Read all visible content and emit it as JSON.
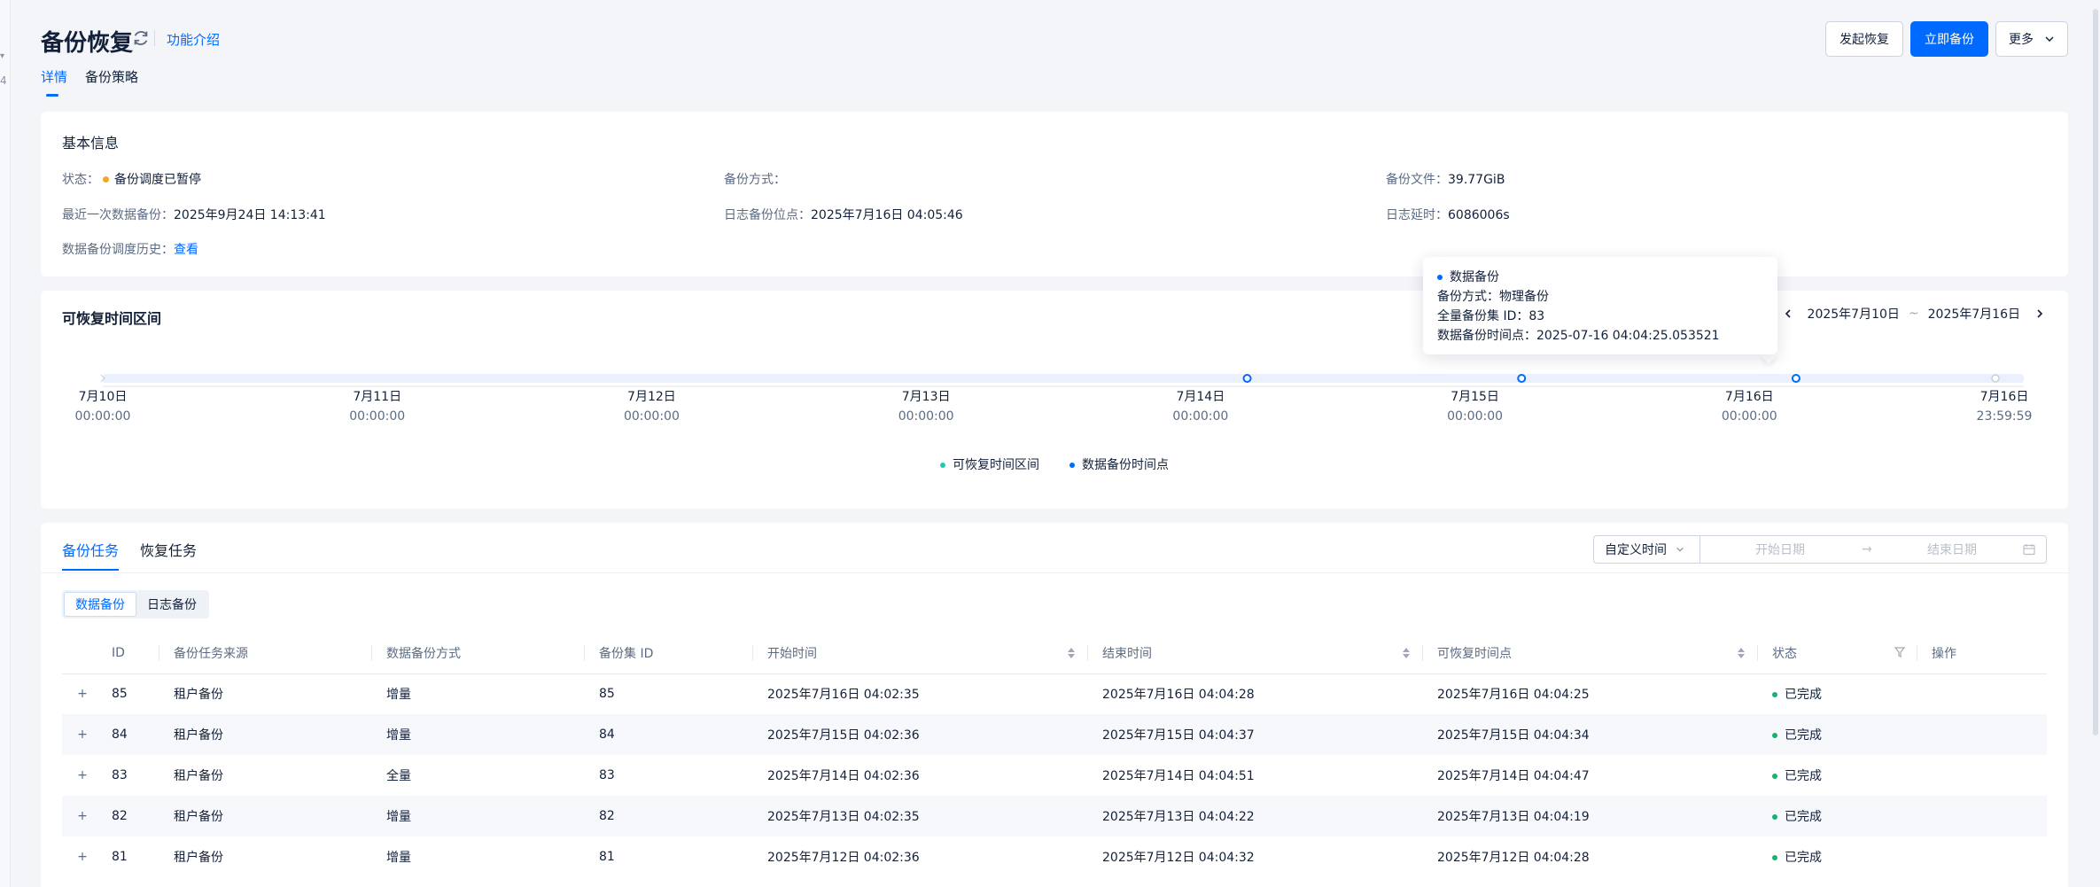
{
  "left_strip": {
    "glyph_top": "▾",
    "glyph_mid": "4"
  },
  "header": {
    "title": "备份恢复",
    "intro_link": "功能介绍",
    "buttons": {
      "restore": "发起恢复",
      "backup_now": "立即备份",
      "more": "更多"
    }
  },
  "page_tabs": [
    {
      "label": "详情"
    },
    {
      "label": "备份策略"
    }
  ],
  "basic_info": {
    "title": "基本信息",
    "status_label": "状态：",
    "status_value": "备份调度已暂停",
    "status_color": "#f5a623",
    "method_label": "备份方式：",
    "method_value": "",
    "file_label": "备份文件：",
    "file_value": "39.77GiB",
    "last_backup_label": "最近一次数据备份：",
    "last_backup_value": "2025年9月24日 14:13:41",
    "log_point_label": "日志备份位点：",
    "log_point_value": "2025年7月16日 04:05:46",
    "log_delay_label": "日志延时：",
    "log_delay_value": "6086006s",
    "history_label": "数据备份调度历史：",
    "history_link": "查看"
  },
  "range": {
    "title": "可恢复时间区间",
    "start_date": "2025年7月10日",
    "end_date": "2025年7月16日",
    "tilde": "~",
    "ticks": [
      {
        "date": "7月10日",
        "time": "00:00:00"
      },
      {
        "date": "7月11日",
        "time": "00:00:00"
      },
      {
        "date": "7月12日",
        "time": "00:00:00"
      },
      {
        "date": "7月13日",
        "time": "00:00:00"
      },
      {
        "date": "7月14日",
        "time": "00:00:00"
      },
      {
        "date": "7月15日",
        "time": "00:00:00"
      },
      {
        "date": "7月16日",
        "time": "00:00:00"
      },
      {
        "date": "7月16日",
        "time": "23:59:59"
      }
    ],
    "backup_point_days": [
      4.17,
      5.17,
      6.17
    ],
    "legend": [
      {
        "label": "可恢复时间区间",
        "color": "#20c9b1"
      },
      {
        "label": "数据备份时间点",
        "color": "#006aff"
      }
    ],
    "tooltip": {
      "title": "数据备份",
      "method_label": "备份方式：",
      "method_value": "物理备份",
      "set_label": "全量备份集 ID：",
      "set_value": "83",
      "time_label": "数据备份时间点：",
      "time_value": "2025-07-16 04:04:25.053521"
    }
  },
  "tasks": {
    "tabs": [
      {
        "label": "备份任务"
      },
      {
        "label": "恢复任务"
      }
    ],
    "time_mode": "自定义时间",
    "start_placeholder": "开始日期",
    "end_placeholder": "结束日期",
    "range_arrow": "→",
    "segments": [
      {
        "label": "数据备份"
      },
      {
        "label": "日志备份"
      }
    ],
    "columns": [
      "ID",
      "备份任务来源",
      "数据备份方式",
      "备份集 ID",
      "开始时间",
      "结束时间",
      "可恢复时间点",
      "状态",
      "操作"
    ],
    "rows": [
      {
        "id": "85",
        "source": "租户备份",
        "method": "增量",
        "set_id": "85",
        "start": "2025年7月16日 04:02:35",
        "end": "2025年7月16日 04:04:28",
        "restorable": "2025年7月16日 04:04:25",
        "status": "已完成"
      },
      {
        "id": "84",
        "source": "租户备份",
        "method": "增量",
        "set_id": "84",
        "start": "2025年7月15日 04:02:36",
        "end": "2025年7月15日 04:04:37",
        "restorable": "2025年7月15日 04:04:34",
        "status": "已完成"
      },
      {
        "id": "83",
        "source": "租户备份",
        "method": "全量",
        "set_id": "83",
        "start": "2025年7月14日 04:02:36",
        "end": "2025年7月14日 04:04:51",
        "restorable": "2025年7月14日 04:04:47",
        "status": "已完成"
      },
      {
        "id": "82",
        "source": "租户备份",
        "method": "增量",
        "set_id": "82",
        "start": "2025年7月13日 04:02:35",
        "end": "2025年7月13日 04:04:22",
        "restorable": "2025年7月13日 04:04:19",
        "status": "已完成"
      },
      {
        "id": "81",
        "source": "租户备份",
        "method": "增量",
        "set_id": "81",
        "start": "2025年7月12日 04:02:36",
        "end": "2025年7月12日 04:04:32",
        "restorable": "2025年7月12日 04:04:28",
        "status": "已完成"
      }
    ]
  },
  "colors": {
    "accent": "#006aff",
    "success": "#15b371",
    "warning": "#f5a623"
  }
}
